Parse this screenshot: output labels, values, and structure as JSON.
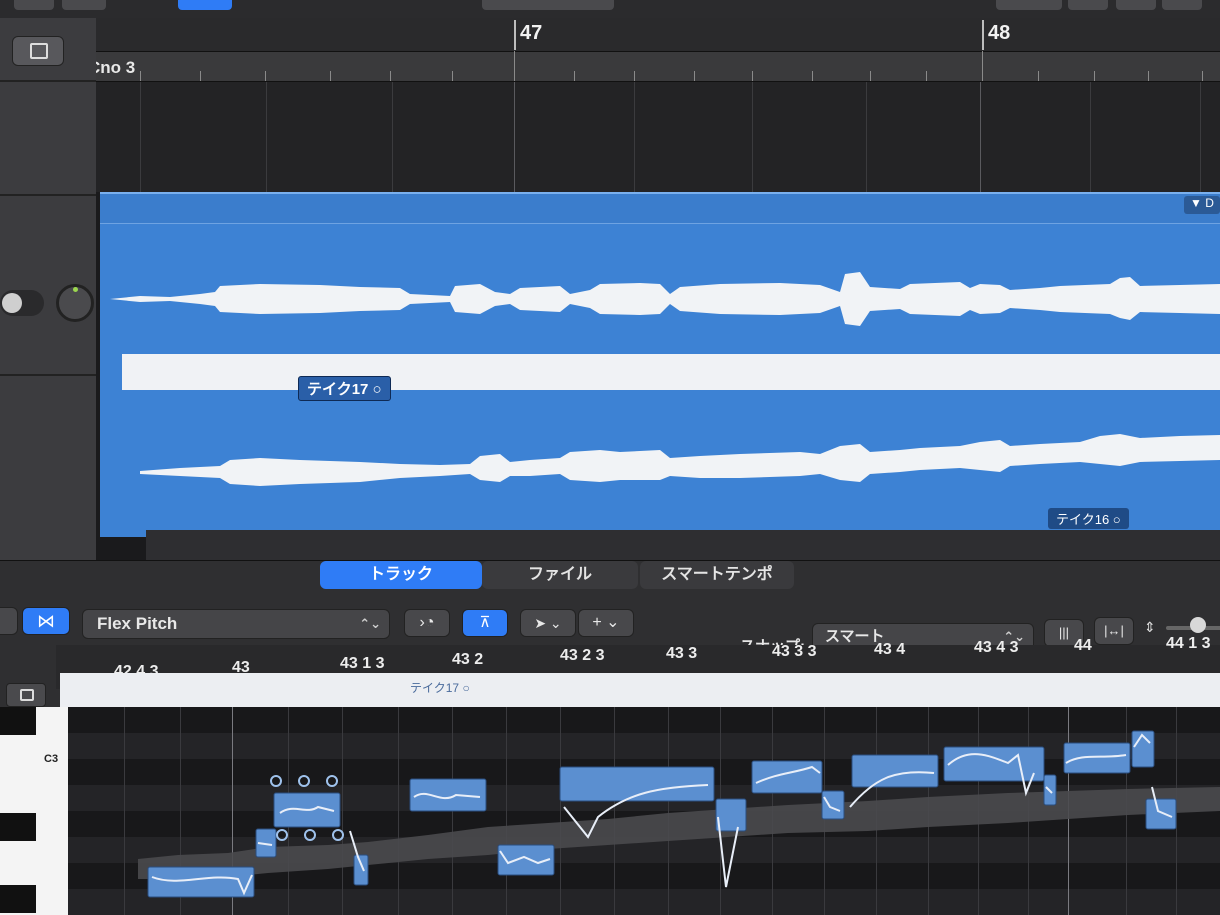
{
  "top_ruler": {
    "bar_47": "47",
    "bar_48": "48"
  },
  "chord_lane": {
    "label": "Cno 3"
  },
  "region": {
    "tag": "▼ D"
  },
  "takes": {
    "take_17": "テイク17 ○",
    "take_16": "テイク16 ○"
  },
  "editor": {
    "tabs": [
      "トラック",
      "ファイル",
      "スマートテンポ"
    ],
    "mode_select": "Flex Pitch",
    "snap_label": "スナップ:",
    "snap_value": "スマート"
  },
  "positions": [
    "42 4 3",
    "43",
    "43 1 3",
    "43 2",
    "43 2 3",
    "43 3",
    "43 3 3",
    "43 4",
    "43 4 3",
    "44",
    "44 1 3"
  ],
  "take_lane_label": "テイク17 ○",
  "keyboard": {
    "c3_label": "C3"
  },
  "icons": [
    "capture-icon",
    "overview-icon",
    "audio-file-icon",
    "flex-mode-icon",
    "pointer-tool-icon",
    "add-tool-icon",
    "waveform-zoom-icon",
    "fit-icon",
    "vertical-zoom-icon"
  ],
  "colors": {
    "accent": "#2f7cf6",
    "region": "#3d82d4",
    "note": "#5b8fd0"
  }
}
